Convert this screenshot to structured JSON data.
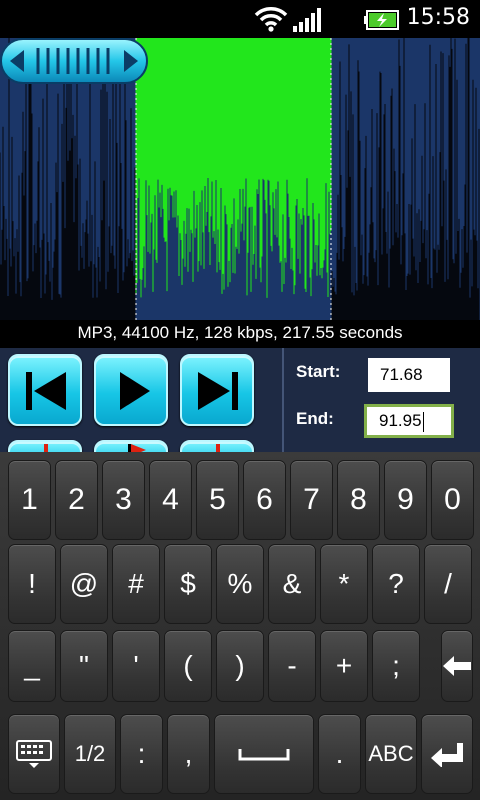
{
  "status": {
    "time": "15:58"
  },
  "info_line": "MP3, 44100 Hz, 128 kbps, 217.55 seconds",
  "selection": {
    "start_label": "Start:",
    "start_value": "71.68",
    "end_label": "End:",
    "end_value": "91.95"
  },
  "colors": {
    "waveform": "#1b3668",
    "selection": "#22e61c",
    "button_accent": "#17c6e6",
    "focus": "#83b04a"
  },
  "keyboard": {
    "row1": [
      "1",
      "2",
      "3",
      "4",
      "5",
      "6",
      "7",
      "8",
      "9",
      "0"
    ],
    "row2": [
      "!",
      "@",
      "#",
      "$",
      "%",
      "&",
      "*",
      "?",
      "/"
    ],
    "row3": [
      "_",
      "\"",
      "'",
      "(",
      ")",
      "-",
      "+",
      ";"
    ],
    "row4": {
      "symbols_page": "1/2",
      "colon": ":",
      "comma": ",",
      "period": ".",
      "abc": "ABC"
    }
  }
}
